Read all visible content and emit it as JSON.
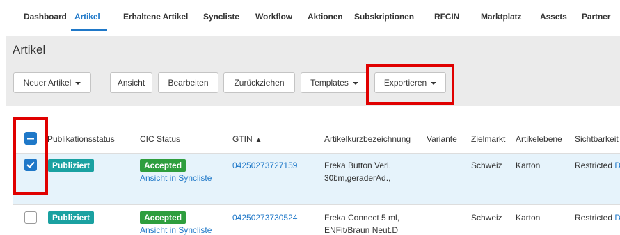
{
  "nav": {
    "items": [
      {
        "label": "Dashboard",
        "active": false
      },
      {
        "label": "Artikel",
        "active": true
      },
      {
        "label": "Erhaltene Artikel",
        "active": false
      },
      {
        "label": "Syncliste",
        "active": false
      },
      {
        "label": "Workflow",
        "active": false
      },
      {
        "label": "Aktionen",
        "active": false
      },
      {
        "label": "Subskriptionen",
        "active": false
      },
      {
        "label": "RFCIN",
        "active": false
      },
      {
        "label": "Marktplatz",
        "active": false
      },
      {
        "label": "Assets",
        "active": false
      },
      {
        "label": "Partner",
        "active": false
      }
    ]
  },
  "page": {
    "title": "Artikel"
  },
  "toolbar": {
    "new_article": "Neuer Artikel",
    "view": "Ansicht",
    "edit": "Bearbeiten",
    "withdraw": "Zurückziehen",
    "templates": "Templates",
    "export": "Exportieren"
  },
  "table": {
    "columns": [
      "Publikationsstatus",
      "CIC Status",
      "GTIN",
      "Artikelkurzbezeichnung",
      "Variante",
      "Zielmarkt",
      "Artikelebene",
      "Sichtbarkeit"
    ],
    "rows": [
      {
        "selected": true,
        "pub_status": "Publiziert",
        "cic_status": "Accepted",
        "cic_link": "Ansicht in Syncliste",
        "gtin": "04250273727159",
        "desc_line1": "Freka Button Verl.",
        "desc_line2": "30cm,geraderAd.,",
        "variante": "",
        "zielmarkt": "Schweiz",
        "ebene": "Karton",
        "sichtbarkeit": "Restricted",
        "sichtbarkeit_extra": "D"
      },
      {
        "selected": false,
        "pub_status": "Publiziert",
        "cic_status": "Accepted",
        "cic_link": "Ansicht in Syncliste",
        "gtin": "04250273730524",
        "desc_line1": "Freka Connect 5 ml,",
        "desc_line2": "ENFit/Braun Neut.D",
        "variante": "",
        "zielmarkt": "Schweiz",
        "ebene": "Karton",
        "sichtbarkeit": "Restricted",
        "sichtbarkeit_extra": "D"
      }
    ]
  },
  "colors": {
    "accent": "#1f78c8",
    "highlight": "#e00000",
    "published": "#1aa1a1",
    "accepted": "#2e9e3e",
    "selected_row": "#e6f3fb"
  }
}
